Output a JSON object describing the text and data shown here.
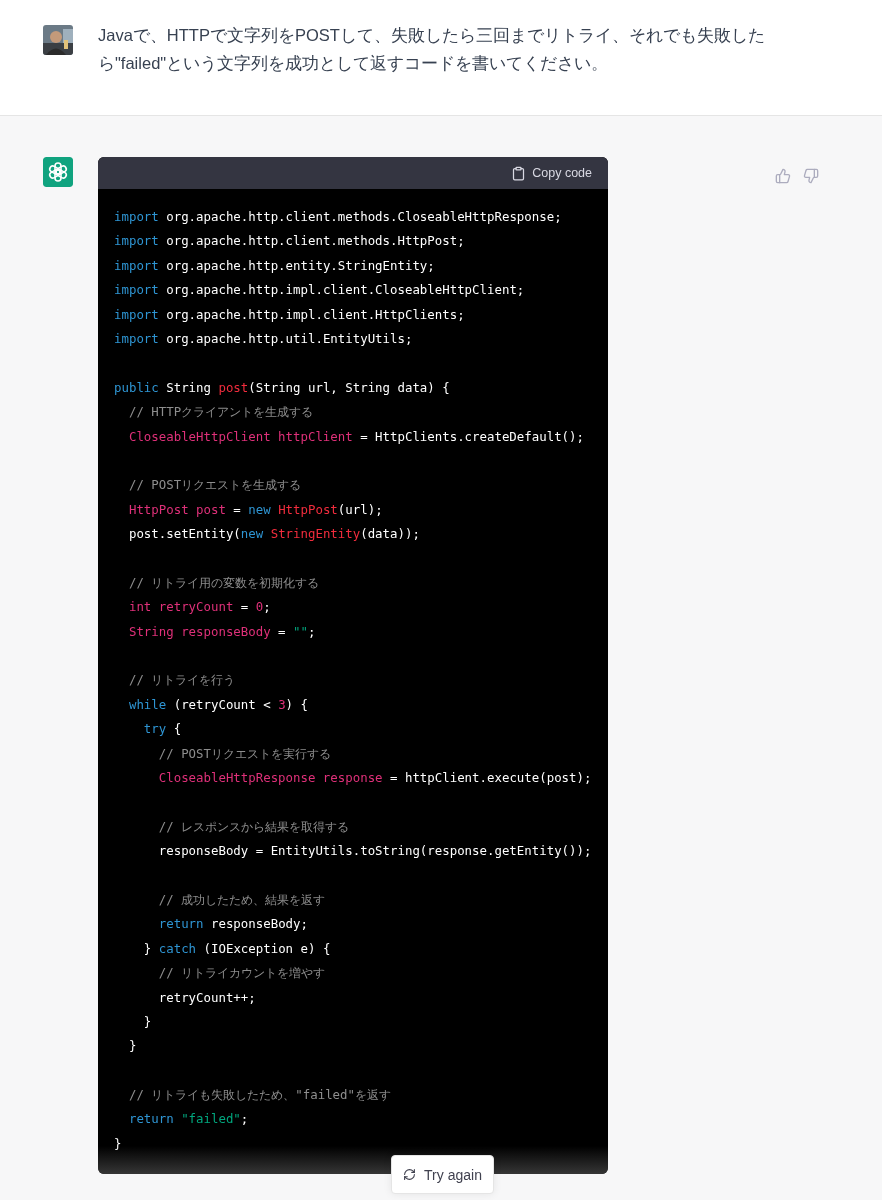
{
  "user_message": {
    "text": "Javaで、HTTPで文字列をPOSTして、失敗したら三回までリトライ、それでも失敗したら\"failed\"という文字列を成功として返すコードを書いてください。"
  },
  "assistant_message": {
    "code_block": {
      "copy_button": "Copy code",
      "lines": [
        {
          "kind": "code",
          "tokens": [
            {
              "kind": "keyword",
              "text": "import"
            },
            {
              "kind": "plain",
              "text": " org.apache.http.client.methods.CloseableHttpResponse;"
            }
          ]
        },
        {
          "kind": "code",
          "tokens": [
            {
              "kind": "keyword",
              "text": "import"
            },
            {
              "kind": "plain",
              "text": " org.apache.http.client.methods.HttpPost;"
            }
          ]
        },
        {
          "kind": "code",
          "tokens": [
            {
              "kind": "keyword",
              "text": "import"
            },
            {
              "kind": "plain",
              "text": " org.apache.http.entity.StringEntity;"
            }
          ]
        },
        {
          "kind": "code",
          "tokens": [
            {
              "kind": "keyword",
              "text": "import"
            },
            {
              "kind": "plain",
              "text": " org.apache.http.impl.client.CloseableHttpClient;"
            }
          ]
        },
        {
          "kind": "code",
          "tokens": [
            {
              "kind": "keyword",
              "text": "import"
            },
            {
              "kind": "plain",
              "text": " org.apache.http.impl.client.HttpClients;"
            }
          ]
        },
        {
          "kind": "code",
          "tokens": [
            {
              "kind": "keyword",
              "text": "import"
            },
            {
              "kind": "plain",
              "text": " org.apache.http.util.EntityUtils;"
            }
          ]
        },
        {
          "kind": "blank"
        },
        {
          "kind": "code",
          "tokens": [
            {
              "kind": "keyword",
              "text": "public"
            },
            {
              "kind": "plain",
              "text": " String "
            },
            {
              "kind": "function",
              "text": "post"
            },
            {
              "kind": "plain",
              "text": "(String url, String data) {"
            }
          ]
        },
        {
          "kind": "code",
          "tokens": [
            {
              "kind": "comment",
              "text": "  // HTTPクライアントを生成する"
            }
          ]
        },
        {
          "kind": "code",
          "tokens": [
            {
              "kind": "class",
              "text": "  CloseableHttpClient httpClient"
            },
            {
              "kind": "plain",
              "text": " = HttpClients.createDefault();"
            }
          ]
        },
        {
          "kind": "blank"
        },
        {
          "kind": "code",
          "tokens": [
            {
              "kind": "comment",
              "text": "  // POSTリクエストを生成する"
            }
          ]
        },
        {
          "kind": "code",
          "tokens": [
            {
              "kind": "class",
              "text": "  HttpPost post"
            },
            {
              "kind": "plain",
              "text": " = "
            },
            {
              "kind": "keyword",
              "text": "new "
            },
            {
              "kind": "function",
              "text": "HttpPost"
            },
            {
              "kind": "plain",
              "text": "(url);"
            }
          ]
        },
        {
          "kind": "code",
          "tokens": [
            {
              "kind": "plain",
              "text": "  post.setEntity("
            },
            {
              "kind": "keyword",
              "text": "new "
            },
            {
              "kind": "function",
              "text": "StringEntity"
            },
            {
              "kind": "plain",
              "text": "(data));"
            }
          ]
        },
        {
          "kind": "blank"
        },
        {
          "kind": "code",
          "tokens": [
            {
              "kind": "comment",
              "text": "  // リトライ用の変数を初期化する"
            }
          ]
        },
        {
          "kind": "code",
          "tokens": [
            {
              "kind": "class",
              "text": "  int retryCount"
            },
            {
              "kind": "plain",
              "text": " = "
            },
            {
              "kind": "number",
              "text": "0"
            },
            {
              "kind": "plain",
              "text": ";"
            }
          ]
        },
        {
          "kind": "code",
          "tokens": [
            {
              "kind": "class",
              "text": "  String responseBody"
            },
            {
              "kind": "plain",
              "text": " = "
            },
            {
              "kind": "string",
              "text": "\"\""
            },
            {
              "kind": "plain",
              "text": ";"
            }
          ]
        },
        {
          "kind": "blank"
        },
        {
          "kind": "code",
          "tokens": [
            {
              "kind": "comment",
              "text": "  // リトライを行う"
            }
          ]
        },
        {
          "kind": "code",
          "tokens": [
            {
              "kind": "keyword",
              "text": "  while"
            },
            {
              "kind": "plain",
              "text": " (retryCount < "
            },
            {
              "kind": "number",
              "text": "3"
            },
            {
              "kind": "plain",
              "text": ") {"
            }
          ]
        },
        {
          "kind": "code",
          "tokens": [
            {
              "kind": "keyword",
              "text": "    try"
            },
            {
              "kind": "plain",
              "text": " {"
            }
          ]
        },
        {
          "kind": "code",
          "tokens": [
            {
              "kind": "comment",
              "text": "      // POSTリクエストを実行する"
            }
          ]
        },
        {
          "kind": "code",
          "tokens": [
            {
              "kind": "class",
              "text": "      CloseableHttpResponse response"
            },
            {
              "kind": "plain",
              "text": " = httpClient.execute(post);"
            }
          ]
        },
        {
          "kind": "blank"
        },
        {
          "kind": "code",
          "tokens": [
            {
              "kind": "comment",
              "text": "      // レスポンスから結果を取得する"
            }
          ]
        },
        {
          "kind": "code",
          "tokens": [
            {
              "kind": "plain",
              "text": "      responseBody = EntityUtils.toString(response.getEntity());"
            }
          ]
        },
        {
          "kind": "blank"
        },
        {
          "kind": "code",
          "tokens": [
            {
              "kind": "comment",
              "text": "      // 成功したため、結果を返す"
            }
          ]
        },
        {
          "kind": "code",
          "tokens": [
            {
              "kind": "keyword",
              "text": "      return"
            },
            {
              "kind": "plain",
              "text": " responseBody;"
            }
          ]
        },
        {
          "kind": "code",
          "tokens": [
            {
              "kind": "plain",
              "text": "    } "
            },
            {
              "kind": "keyword",
              "text": "catch"
            },
            {
              "kind": "plain",
              "text": " (IOException e) {"
            }
          ]
        },
        {
          "kind": "code",
          "tokens": [
            {
              "kind": "comment",
              "text": "      // リトライカウントを増やす"
            }
          ]
        },
        {
          "kind": "code",
          "tokens": [
            {
              "kind": "plain",
              "text": "      retryCount++;"
            }
          ]
        },
        {
          "kind": "code",
          "tokens": [
            {
              "kind": "plain",
              "text": "    }"
            }
          ]
        },
        {
          "kind": "code",
          "tokens": [
            {
              "kind": "plain",
              "text": "  }"
            }
          ]
        },
        {
          "kind": "blank"
        },
        {
          "kind": "code",
          "tokens": [
            {
              "kind": "comment",
              "text": "  // リトライも失敗したため、\"failed\"を返す"
            }
          ]
        },
        {
          "kind": "code",
          "tokens": [
            {
              "kind": "keyword",
              "text": "  return "
            },
            {
              "kind": "string",
              "text": "\"failed\""
            },
            {
              "kind": "plain",
              "text": ";"
            }
          ]
        },
        {
          "kind": "code",
          "tokens": [
            {
              "kind": "plain",
              "text": "}"
            }
          ]
        }
      ]
    },
    "try_again_button": "Try again"
  }
}
